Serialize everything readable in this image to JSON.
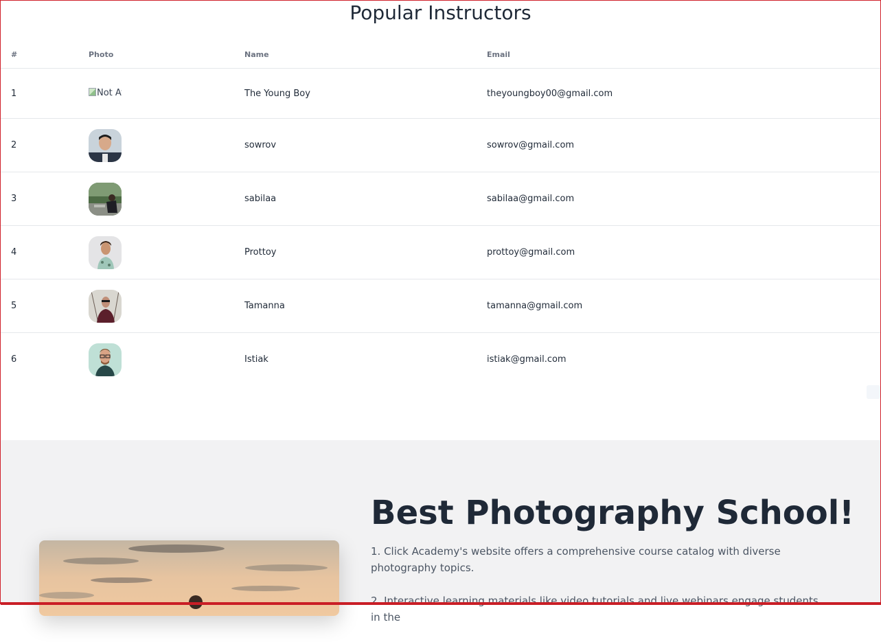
{
  "section": {
    "title": "Popular Instructors"
  },
  "table": {
    "headers": [
      "#",
      "Photo",
      "Name",
      "Email"
    ],
    "rows": [
      {
        "num": "1",
        "photo_alt": "Not Available",
        "name": "The Young Boy",
        "email": "theyoungboy00@gmail.com"
      },
      {
        "num": "2",
        "name": "sowrov",
        "email": "sowrov@gmail.com"
      },
      {
        "num": "3",
        "name": "sabilaa",
        "email": "sabilaa@gmail.com"
      },
      {
        "num": "4",
        "name": "Prottoy",
        "email": "prottoy@gmail.com"
      },
      {
        "num": "5",
        "name": "Tamanna",
        "email": "tamanna@gmail.com"
      },
      {
        "num": "6",
        "name": "Istiak",
        "email": "istiak@gmail.com"
      }
    ]
  },
  "promo": {
    "title": "Best Photography School!",
    "paragraphs": [
      "1. Click Academy's website offers a comprehensive course catalog with diverse photography topics.",
      "2. Interactive learning materials like video tutorials and live webinars engage students in the"
    ]
  },
  "colors": {
    "accent_border": "#d0202a",
    "promo_bg": "#f2f2f3",
    "text": "#1f2937"
  }
}
